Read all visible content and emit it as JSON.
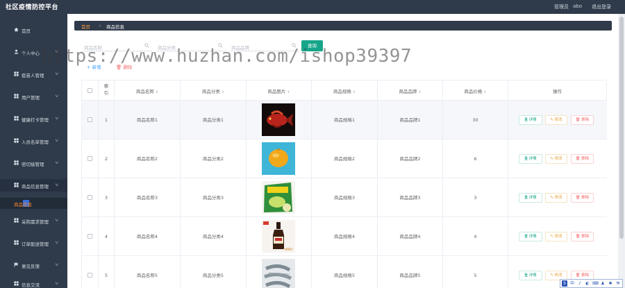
{
  "app": {
    "title": "社区疫情防控平台",
    "user_role": "管理员",
    "user_name": "abo",
    "logout": "退出登录"
  },
  "sidebar": {
    "items": [
      {
        "label": "首页",
        "icon": "home-icon",
        "chevron": false
      },
      {
        "label": "个人中心",
        "icon": "user-icon",
        "chevron": true
      },
      {
        "label": "疫苗人管理",
        "icon": "grid-icon",
        "chevron": true
      },
      {
        "label": "用户管理",
        "icon": "grid-icon",
        "chevron": true
      },
      {
        "label": "健康打卡管理",
        "icon": "grid-icon",
        "chevron": true
      },
      {
        "label": "入员名单管理",
        "icon": "grid-icon",
        "chevron": true
      },
      {
        "label": "密切接管理",
        "icon": "grid-icon",
        "chevron": true
      },
      {
        "label": "商品信息管理",
        "icon": "grid-icon",
        "chevron": true
      },
      {
        "label": "采购需求管理",
        "icon": "grid-icon",
        "chevron": true
      },
      {
        "label": "订单配送管理",
        "icon": "grid-icon",
        "chevron": true
      },
      {
        "label": "意见反馈",
        "icon": "flag-icon",
        "chevron": true
      },
      {
        "label": "信息交流",
        "icon": "grid-icon",
        "chevron": true
      }
    ],
    "sub_item": "商品信息"
  },
  "breadcrumb": {
    "home": "首页",
    "separator": "›",
    "current": "商品信息"
  },
  "search": {
    "name_placeholder": "商品名称",
    "category_placeholder": "商品分类",
    "brand_placeholder": "商品品牌",
    "query_button": "查询"
  },
  "actions": {
    "add": "+ 新增",
    "delete": "删除"
  },
  "table": {
    "headers": [
      "索引",
      "商品名称",
      "商品分类",
      "商品图片",
      "商品规格",
      "商品品牌",
      "商品价格",
      "操作"
    ],
    "rows": [
      {
        "index": "1",
        "name": "商品名称1",
        "category": "商品分类1",
        "image": "red-fish",
        "spec": "商品规格1",
        "brand": "商品品牌1",
        "price": "30"
      },
      {
        "index": "2",
        "name": "商品名称2",
        "category": "商品分类2",
        "image": "lemon",
        "spec": "商品规格2",
        "brand": "商品品牌2",
        "price": "6"
      },
      {
        "index": "3",
        "name": "商品名称3",
        "category": "商品分类3",
        "image": "food-bag",
        "spec": "商品规格3",
        "brand": "商品品牌3",
        "price": "3"
      },
      {
        "index": "4",
        "name": "商品名称4",
        "category": "商品分类4",
        "image": "sauce-bottle",
        "spec": "商品规格4",
        "brand": "商品品牌4",
        "price": "4"
      },
      {
        "index": "5",
        "name": "商品名称5",
        "category": "商品分类5",
        "image": "shrimp",
        "spec": "商品规格5",
        "brand": "商品品牌5",
        "price": "5"
      }
    ],
    "row_buttons": {
      "detail": "详情",
      "edit": "修改",
      "delete": "删除"
    }
  },
  "watermark": "https://www.huzhan.com/ishop39397",
  "ime": {
    "logo": "S",
    "items": [
      "中",
      "♪",
      "◐",
      "⌨",
      "♟",
      "✱",
      "⚒"
    ]
  },
  "colors": {
    "sidebar": "#2f3a4a",
    "accent": "#17a589",
    "warning": "#e6a23c",
    "danger": "#f56c6c",
    "highlight": "#ff8a2a"
  }
}
